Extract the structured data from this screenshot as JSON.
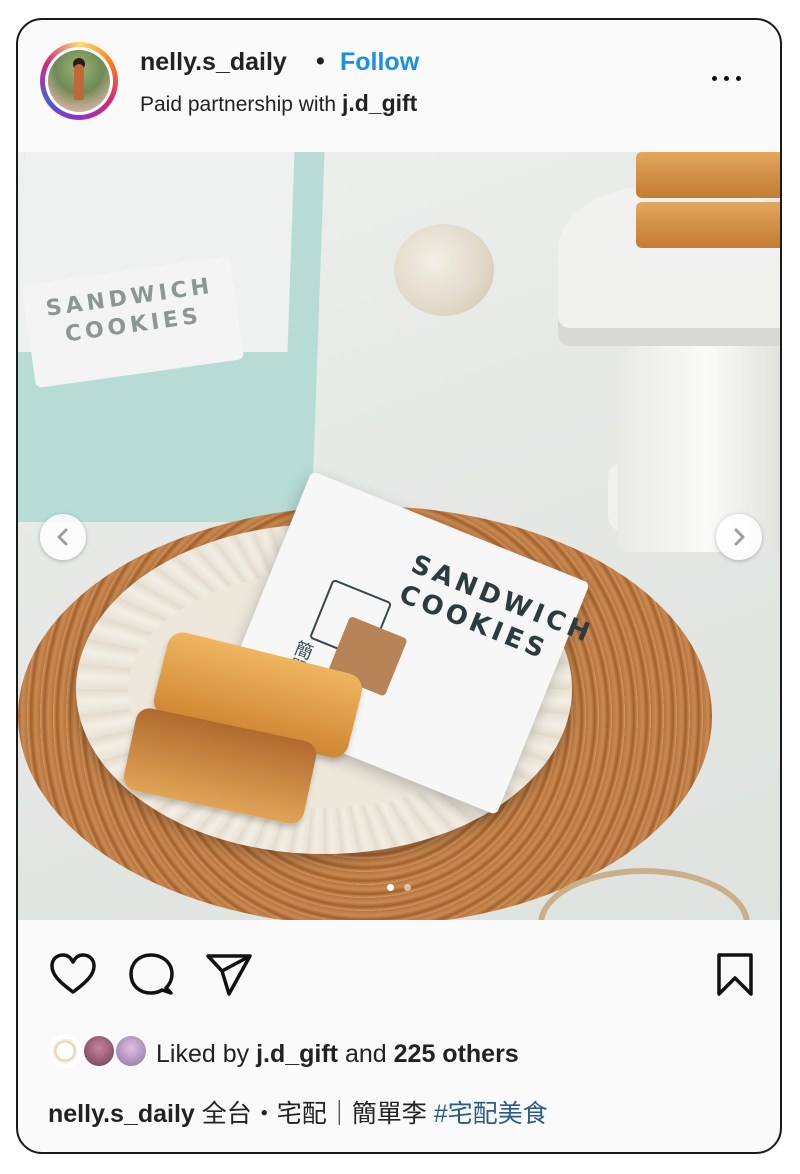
{
  "post": {
    "username": "nelly.s_daily",
    "separator": "•",
    "follow_label": "Follow",
    "sponsor_prefix": "Paid partnership with",
    "sponsor_partner": "j.d_gift"
  },
  "photo": {
    "packet_title_line1": "SANDWICH",
    "packet_title_line2": "COOKIES",
    "packet_brand": "簡單李",
    "bg_pack_text_1": "SANDWICH",
    "bg_pack_text_2": "COOKIES",
    "carousel_dots": 2,
    "carousel_active_index": 0
  },
  "actions": {
    "like_icon": "heart-icon",
    "comment_icon": "comment-icon",
    "share_icon": "share-icon",
    "save_icon": "bookmark-icon"
  },
  "likes": {
    "prefix": "Liked by",
    "first_user": "j.d_gift",
    "and": "and",
    "count": "225 others"
  },
  "caption": {
    "username": "nelly.s_daily",
    "text": "全台・宅配｜簡單李",
    "hashtag": "#宅配美食"
  },
  "colors": {
    "follow": "#1b8ee8",
    "hashtag": "#2a5a86",
    "border": "#1a1a1a"
  }
}
